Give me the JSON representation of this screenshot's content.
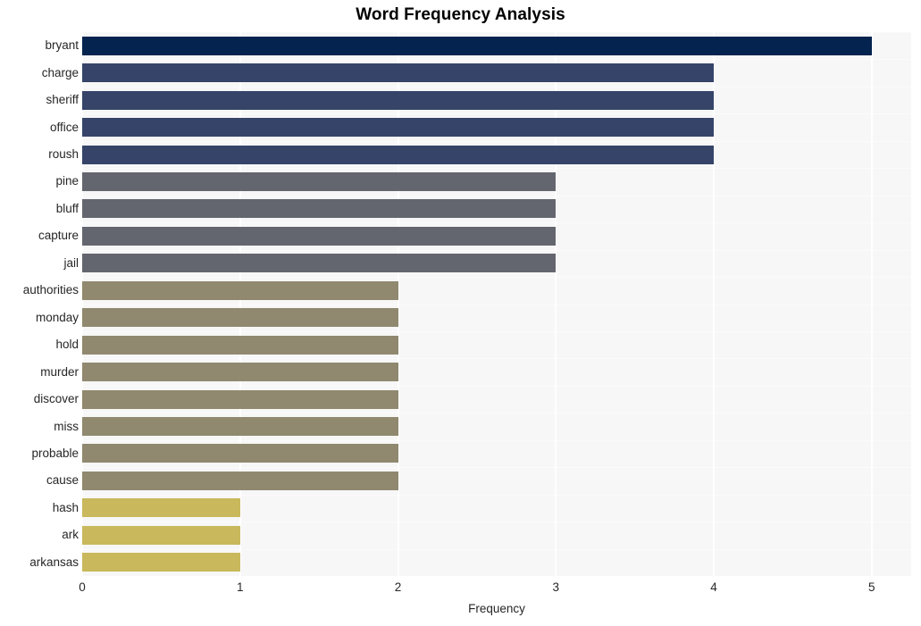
{
  "chart_data": {
    "type": "bar",
    "orientation": "horizontal",
    "title": "Word Frequency Analysis",
    "xlabel": "Frequency",
    "ylabel": "",
    "xlim": [
      0,
      5.25
    ],
    "xticks": [
      "0",
      "1",
      "2",
      "3",
      "4",
      "5"
    ],
    "xtick_values": [
      0,
      1,
      2,
      3,
      4,
      5
    ],
    "grid": "vertical-white-on-light-gray",
    "legend": "none",
    "categories": [
      "bryant",
      "charge",
      "sheriff",
      "office",
      "roush",
      "pine",
      "bluff",
      "capture",
      "jail",
      "authorities",
      "monday",
      "hold",
      "murder",
      "discover",
      "miss",
      "probable",
      "cause",
      "hash",
      "ark",
      "arkansas"
    ],
    "values": [
      5,
      4,
      4,
      4,
      4,
      3,
      3,
      3,
      3,
      2,
      2,
      2,
      2,
      2,
      2,
      2,
      2,
      1,
      1,
      1
    ],
    "bar_colors": [
      "#04234f",
      "#364469",
      "#364469",
      "#364469",
      "#364469",
      "#64666f",
      "#64666f",
      "#64666f",
      "#64666f",
      "#90896f",
      "#90896f",
      "#90896f",
      "#90896f",
      "#90896f",
      "#90896f",
      "#90896f",
      "#90896f",
      "#c9b85c",
      "#c9b85c",
      "#c9b85c"
    ]
  },
  "style": {
    "figure_background": "#ffffff",
    "plot_background": "#f7f7f7",
    "gridline_color": "#ffffff",
    "text_color": "#262626",
    "title_color": "#000000"
  }
}
